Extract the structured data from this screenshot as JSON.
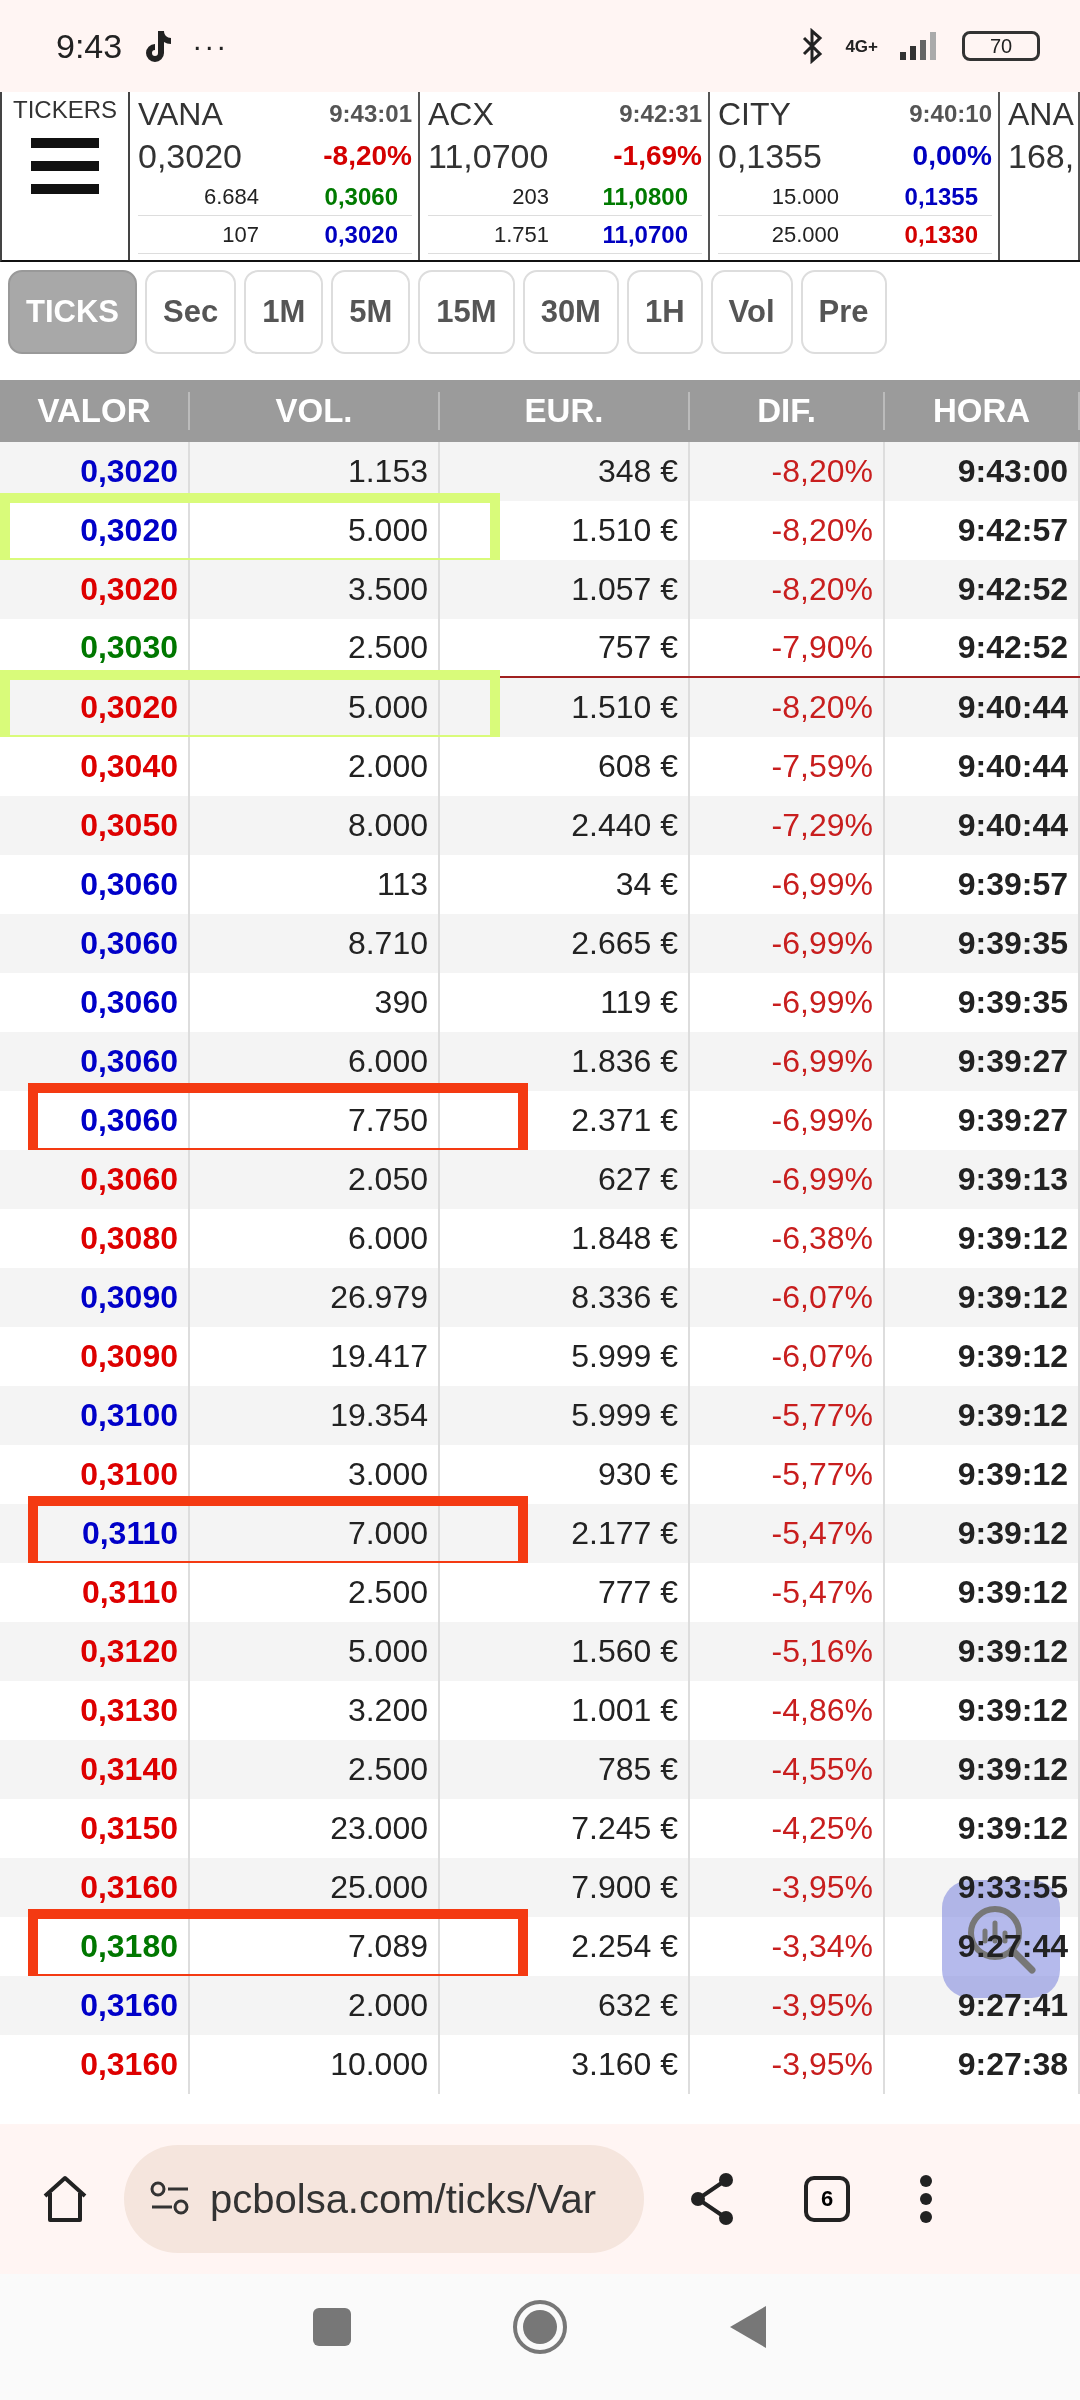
{
  "status_bar": {
    "time": "9:43",
    "dots": "···",
    "network": "4G+",
    "battery": "70"
  },
  "tickers_label": "TICKERS",
  "tickers": [
    {
      "name": "VANA",
      "time": "9:43:01",
      "price": "0,3020",
      "change": {
        "text": "-8,20%",
        "color": "#d40000"
      },
      "vol_1": "6.684",
      "bid": {
        "text": "0,3060",
        "color": "#007a00"
      },
      "vol_2": "107",
      "ask": {
        "text": "0,3020",
        "color": "#0000c0"
      }
    },
    {
      "name": "ACX",
      "time": "9:42:31",
      "price": "11,0700",
      "change": {
        "text": "-1,69%",
        "color": "#d40000"
      },
      "vol_1": "203",
      "bid": {
        "text": "11,0800",
        "color": "#007a00"
      },
      "vol_2": "1.751",
      "ask": {
        "text": "11,0700",
        "color": "#0000c0"
      }
    },
    {
      "name": "CITY",
      "time": "9:40:10",
      "price": "0,1355",
      "change": {
        "text": "0,00%",
        "color": "#0000c0"
      },
      "vol_1": "15.000",
      "bid": {
        "text": "0,1355",
        "color": "#0000c0"
      },
      "vol_2": "25.000",
      "ask": {
        "text": "0,1330",
        "color": "#d40000"
      }
    },
    {
      "name": "ANA",
      "price": "168,"
    }
  ],
  "tabs": [
    {
      "label": "TICKS",
      "selected": true
    },
    {
      "label": "Sec",
      "selected": false
    },
    {
      "label": "1M",
      "selected": false
    },
    {
      "label": "5M",
      "selected": false
    },
    {
      "label": "15M",
      "selected": false
    },
    {
      "label": "30M",
      "selected": false
    },
    {
      "label": "1H",
      "selected": false
    },
    {
      "label": "Vol",
      "selected": false
    },
    {
      "label": "Pre",
      "selected": false
    }
  ],
  "table": {
    "columns": [
      "VALOR",
      "VOL.",
      "EUR.",
      "DIF.",
      "HORA"
    ],
    "rows": [
      {
        "valor": "0,3020",
        "color": "#0000c8",
        "vol": "1.153",
        "eur": "348 €",
        "dif": "-8,20%",
        "hora": "9:43:00",
        "divider": false
      },
      {
        "valor": "0,3020",
        "color": "#0000c8",
        "vol": "5.000",
        "eur": "1.510 €",
        "dif": "-8,20%",
        "hora": "9:42:57",
        "divider": false,
        "highlight": {
          "color": "#d9fb7a"
        }
      },
      {
        "valor": "0,3020",
        "color": "#dd0000",
        "vol": "3.500",
        "eur": "1.057 €",
        "dif": "-8,20%",
        "hora": "9:42:52",
        "divider": false
      },
      {
        "valor": "0,3030",
        "color": "#007700",
        "vol": "2.500",
        "eur": "757 €",
        "dif": "-7,90%",
        "hora": "9:42:52",
        "divider": true
      },
      {
        "valor": "0,3020",
        "color": "#dd0000",
        "vol": "5.000",
        "eur": "1.510 €",
        "dif": "-8,20%",
        "hora": "9:40:44",
        "divider": false,
        "highlight": {
          "color": "#d9fb7a"
        }
      },
      {
        "valor": "0,3040",
        "color": "#dd0000",
        "vol": "2.000",
        "eur": "608 €",
        "dif": "-7,59%",
        "hora": "9:40:44",
        "divider": false
      },
      {
        "valor": "0,3050",
        "color": "#dd0000",
        "vol": "8.000",
        "eur": "2.440 €",
        "dif": "-7,29%",
        "hora": "9:40:44",
        "divider": false
      },
      {
        "valor": "0,3060",
        "color": "#0000c8",
        "vol": "113",
        "eur": "34 €",
        "dif": "-6,99%",
        "hora": "9:39:57",
        "divider": false
      },
      {
        "valor": "0,3060",
        "color": "#0000c8",
        "vol": "8.710",
        "eur": "2.665 €",
        "dif": "-6,99%",
        "hora": "9:39:35",
        "divider": false
      },
      {
        "valor": "0,3060",
        "color": "#0000c8",
        "vol": "390",
        "eur": "119 €",
        "dif": "-6,99%",
        "hora": "9:39:35",
        "divider": false
      },
      {
        "valor": "0,3060",
        "color": "#0000c8",
        "vol": "6.000",
        "eur": "1.836 €",
        "dif": "-6,99%",
        "hora": "9:39:27",
        "divider": false
      },
      {
        "valor": "0,3060",
        "color": "#0000c8",
        "vol": "7.750",
        "eur": "2.371 €",
        "dif": "-6,99%",
        "hora": "9:39:27",
        "divider": false,
        "highlight": {
          "color": "#f43a12"
        }
      },
      {
        "valor": "0,3060",
        "color": "#dd0000",
        "vol": "2.050",
        "eur": "627 €",
        "dif": "-6,99%",
        "hora": "9:39:13",
        "divider": false
      },
      {
        "valor": "0,3080",
        "color": "#dd0000",
        "vol": "6.000",
        "eur": "1.848 €",
        "dif": "-6,38%",
        "hora": "9:39:12",
        "divider": false
      },
      {
        "valor": "0,3090",
        "color": "#0000c8",
        "vol": "26.979",
        "eur": "8.336 €",
        "dif": "-6,07%",
        "hora": "9:39:12",
        "divider": false
      },
      {
        "valor": "0,3090",
        "color": "#dd0000",
        "vol": "19.417",
        "eur": "5.999 €",
        "dif": "-6,07%",
        "hora": "9:39:12",
        "divider": false
      },
      {
        "valor": "0,3100",
        "color": "#0000c8",
        "vol": "19.354",
        "eur": "5.999 €",
        "dif": "-5,77%",
        "hora": "9:39:12",
        "divider": false
      },
      {
        "valor": "0,3100",
        "color": "#dd0000",
        "vol": "3.000",
        "eur": "930 €",
        "dif": "-5,77%",
        "hora": "9:39:12",
        "divider": false
      },
      {
        "valor": "0,3110",
        "color": "#0000c8",
        "vol": "7.000",
        "eur": "2.177 €",
        "dif": "-5,47%",
        "hora": "9:39:12",
        "divider": false,
        "highlight": {
          "color": "#f43a12"
        }
      },
      {
        "valor": "0,3110",
        "color": "#dd0000",
        "vol": "2.500",
        "eur": "777 €",
        "dif": "-5,47%",
        "hora": "9:39:12",
        "divider": false
      },
      {
        "valor": "0,3120",
        "color": "#dd0000",
        "vol": "5.000",
        "eur": "1.560 €",
        "dif": "-5,16%",
        "hora": "9:39:12",
        "divider": false
      },
      {
        "valor": "0,3130",
        "color": "#dd0000",
        "vol": "3.200",
        "eur": "1.001 €",
        "dif": "-4,86%",
        "hora": "9:39:12",
        "divider": false
      },
      {
        "valor": "0,3140",
        "color": "#dd0000",
        "vol": "2.500",
        "eur": "785 €",
        "dif": "-4,55%",
        "hora": "9:39:12",
        "divider": false
      },
      {
        "valor": "0,3150",
        "color": "#dd0000",
        "vol": "23.000",
        "eur": "7.245 €",
        "dif": "-4,25%",
        "hora": "9:39:12",
        "divider": false
      },
      {
        "valor": "0,3160",
        "color": "#dd0000",
        "vol": "25.000",
        "eur": "7.900 €",
        "dif": "-3,95%",
        "hora": "9:33:55",
        "divider": false
      },
      {
        "valor": "0,3180",
        "color": "#007700",
        "vol": "7.089",
        "eur": "2.254 €",
        "dif": "-3,34%",
        "hora": "9:27:44",
        "divider": false,
        "highlight": {
          "color": "#f43a12"
        }
      },
      {
        "valor": "0,3160",
        "color": "#0000c8",
        "vol": "2.000",
        "eur": "632 €",
        "dif": "-3,95%",
        "hora": "9:27:41",
        "divider": false
      },
      {
        "valor": "0,3160",
        "color": "#dd0000",
        "vol": "10.000",
        "eur": "3.160 €",
        "dif": "-3,95%",
        "hora": "9:27:38",
        "divider": false
      }
    ]
  },
  "browser": {
    "url": "pcbolsa.com/ticks/Var",
    "tab_count": "6"
  }
}
